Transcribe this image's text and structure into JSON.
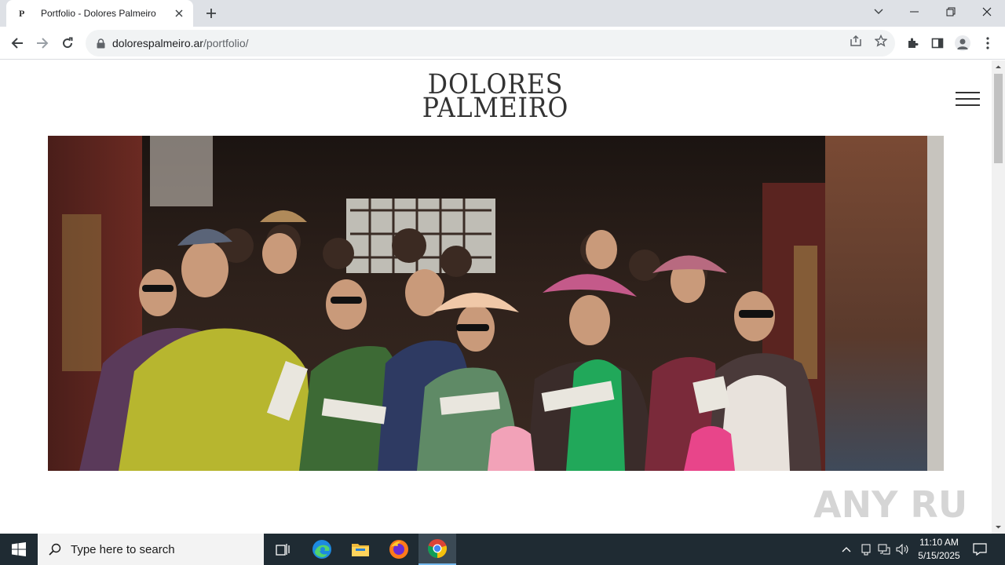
{
  "browser": {
    "tab_title": "Portfolio - Dolores Palmeiro",
    "tab_favicon": "P",
    "url_host": "dolorespalmeiro.ar",
    "url_path": "/portfolio/"
  },
  "page": {
    "logo_line1": "DOLORES",
    "logo_line2": "PALMEIRO",
    "watermark": "ANY RUN"
  },
  "taskbar": {
    "search_placeholder": "Type here to search",
    "time": "11:10 AM",
    "date": "5/15/2025"
  },
  "colors": {
    "tabstrip": "#dee1e6",
    "taskbar": "#1f2b33",
    "logo": "#333333"
  }
}
